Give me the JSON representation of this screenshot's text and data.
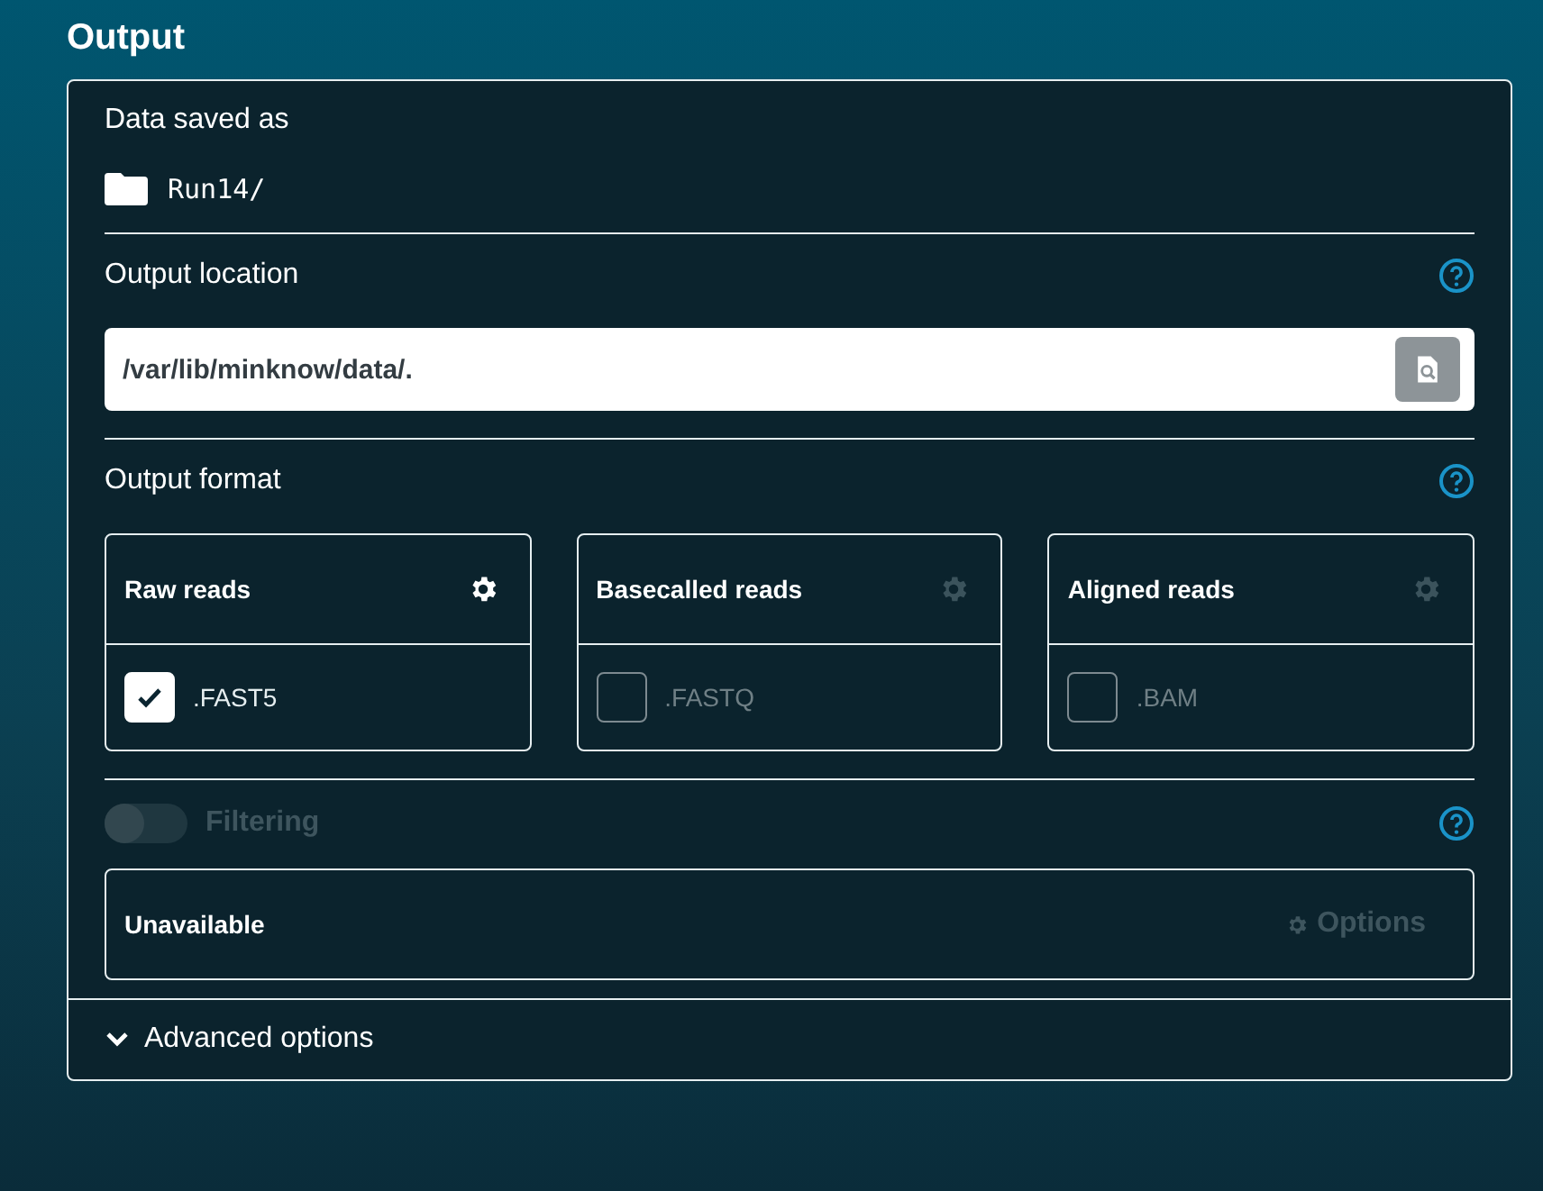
{
  "title": "Output",
  "saved": {
    "label": "Data saved as",
    "folder": "Run14/"
  },
  "location": {
    "label": "Output location",
    "value": "/var/lib/minknow/data/."
  },
  "format": {
    "label": "Output format",
    "options": [
      {
        "title": "Raw reads",
        "enabled": true,
        "extension": ".FAST5",
        "checked": true
      },
      {
        "title": "Basecalled reads",
        "enabled": false,
        "extension": ".FASTQ",
        "checked": false
      },
      {
        "title": "Aligned reads",
        "enabled": false,
        "extension": ".BAM",
        "checked": false
      }
    ]
  },
  "filtering": {
    "label": "Filtering",
    "on": false,
    "disabled": true,
    "status": "Unavailable",
    "options_button": {
      "label": "Options",
      "disabled": true
    }
  },
  "advanced": {
    "label": "Advanced options",
    "expanded": false
  }
}
